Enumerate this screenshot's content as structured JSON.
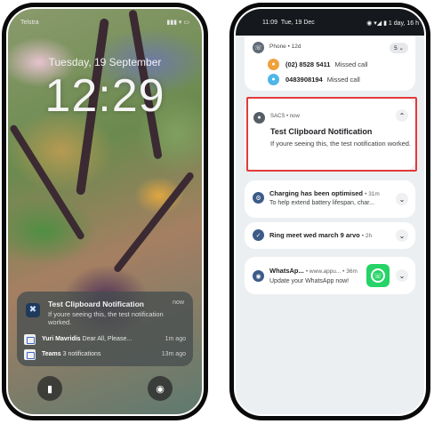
{
  "lock_screen": {
    "carrier": "Telstra",
    "status_icons": "▮▮▮ ▾ ▭",
    "date": "Tuesday, 19 September",
    "time": "12:29",
    "notification": {
      "title": "Test Clipboard Notification",
      "time": "now",
      "body": "If youre seeing this, the test notification worked."
    },
    "rows": [
      {
        "sender": "Yuri Mavridis",
        "preview": "Dear All, Please...",
        "time": "1m ago"
      },
      {
        "sender": "Teams",
        "preview": "3 notifications",
        "time": "13m ago"
      }
    ]
  },
  "shade": {
    "status_time": "11:09",
    "status_date": "Tue, 19 Dec",
    "status_right": "◉ ▾◢ ▮ 1 day, 16 h",
    "phone_group": {
      "app": "Phone • 12d",
      "count": "5",
      "calls": [
        {
          "number": "(02) 8528 5411",
          "label": "Missed call"
        },
        {
          "number": "0483908194",
          "label": "Missed call"
        }
      ]
    },
    "sacs": {
      "app": "SACS • now",
      "title": "Test Clipboard Notification",
      "body": "If youre seeing this, the test notification worked."
    },
    "battery": {
      "title": "Charging has been optimised",
      "meta": "• 31m",
      "sub": "To help extend battery lifespan, char..."
    },
    "ring": {
      "title": "Ring meet wed march 9 arvo",
      "meta": "• 2h"
    },
    "whatsapp": {
      "title": "WhatsAp...",
      "meta": "• www.appu... • 36m",
      "sub": "Update your WhatsApp now!"
    }
  },
  "colors": {
    "highlight": "#e33a3a",
    "whatsapp": "#25d366",
    "shade_bg": "#eceff1"
  }
}
